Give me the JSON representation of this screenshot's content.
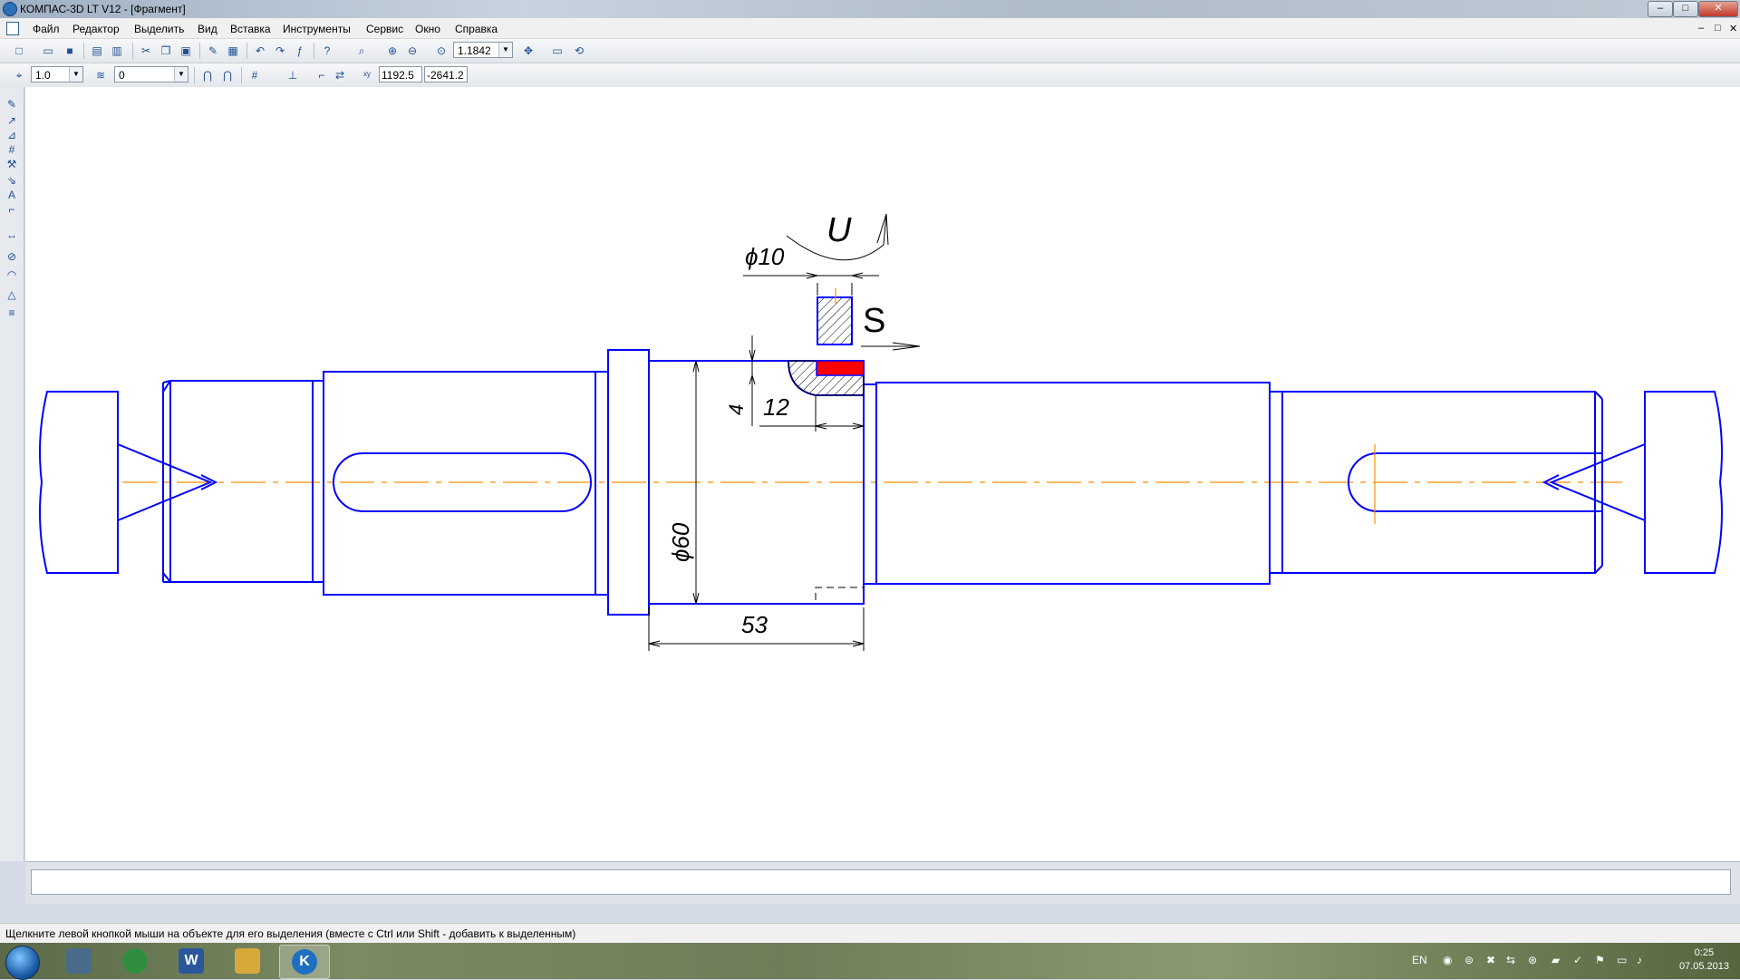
{
  "window": {
    "title": "КОМПАС-3D LT V12 - [Фрагмент]",
    "min": "–",
    "max": "□",
    "close": "✕"
  },
  "menu": {
    "items": [
      "Файл",
      "Редактор",
      "Выделить",
      "Вид",
      "Вставка",
      "Инструменты",
      "Сервис",
      "Окно",
      "Справка"
    ],
    "mdi": [
      "–",
      "□",
      "✕"
    ]
  },
  "toolbar1": {
    "zoom_value": "1.1842"
  },
  "toolbar2": {
    "step_value": "1.0",
    "layer_value": "0",
    "coord_x": "1192.5",
    "coord_y": "-2641.2"
  },
  "drawing": {
    "dims": {
      "d10": "ϕ10",
      "d60": "ϕ60",
      "len53": "53",
      "len12": "12",
      "depth4": "4"
    },
    "symbols": {
      "rotation": "U",
      "feed": "S"
    },
    "colors": {
      "contour": "#0000ff",
      "axis": "#ff8c00",
      "highlight": "#ff0000",
      "dim": "#000000"
    }
  },
  "status": "Щелкните левой кнопкой мыши на объекте для его выделения (вместе с Ctrl или Shift - добавить к выделенным)",
  "taskbar": {
    "tray_lang": "EN",
    "time": "0:25",
    "date": "07.05.2013",
    "apps": [
      {
        "name": "computer",
        "label": "",
        "color": "#4a6b8a"
      },
      {
        "name": "chrome",
        "label": "",
        "color": "#2f8f3f"
      },
      {
        "name": "word",
        "label": "W",
        "color": "#2b579a"
      },
      {
        "name": "explorer",
        "label": "",
        "color": "#d6a93a"
      },
      {
        "name": "kompas",
        "label": "K",
        "color": "#1f6fc0"
      }
    ]
  }
}
